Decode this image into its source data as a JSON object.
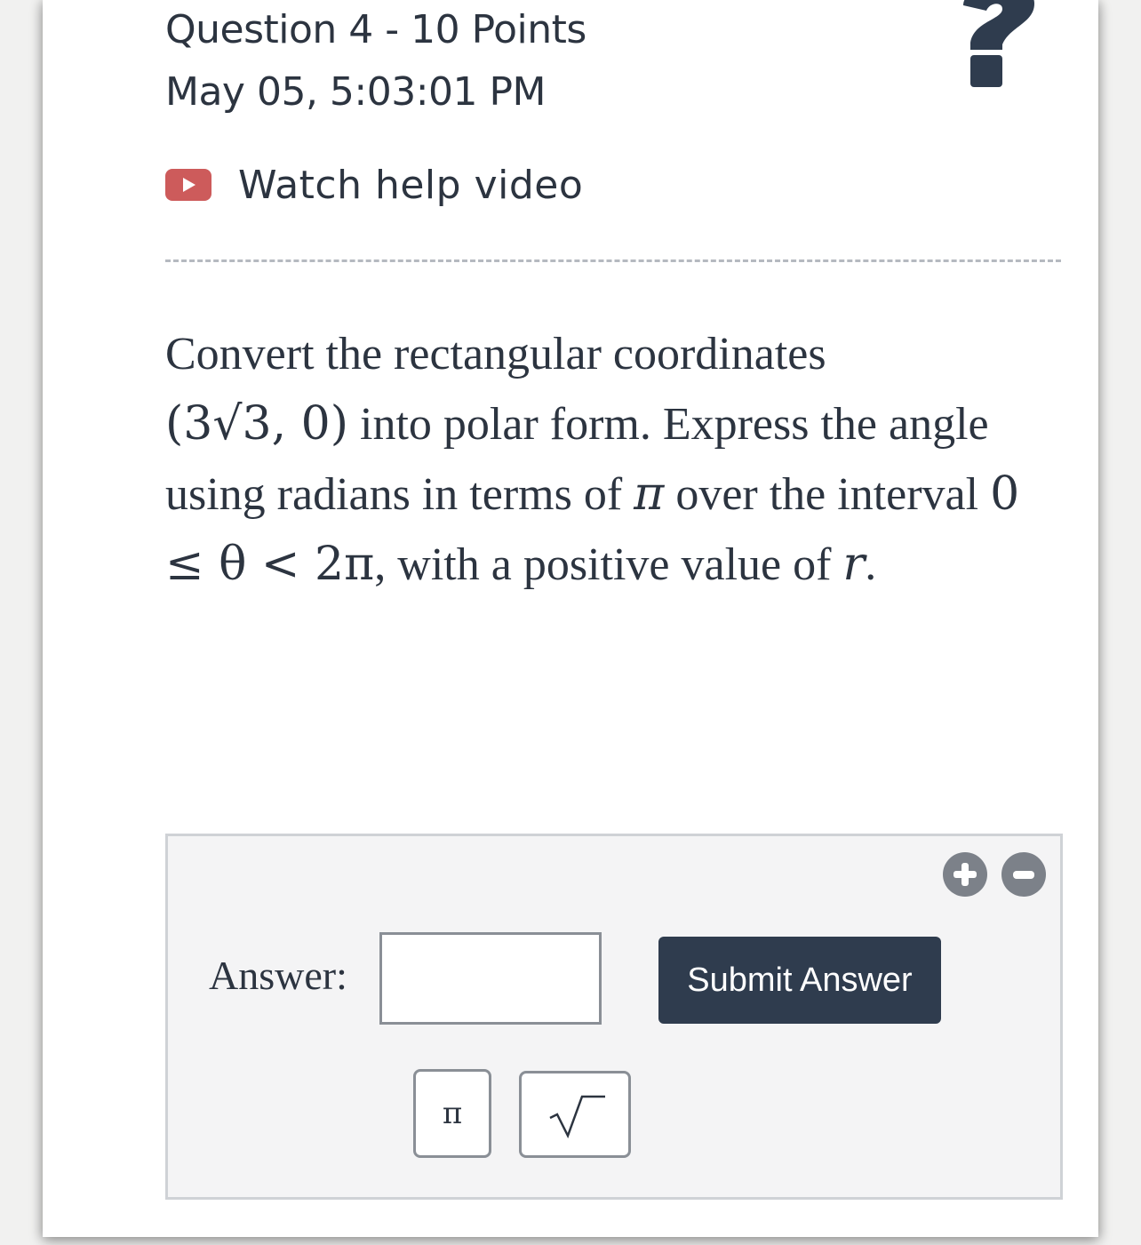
{
  "header": {
    "question_title": "Question 4 - 10 Points",
    "timestamp": "May 05, 5:03:01 PM",
    "help_icon": "question-mark-icon"
  },
  "help_video": {
    "icon": "video-play-icon",
    "label": "Watch help video"
  },
  "question": {
    "p1": "Convert the rectangular coordinates",
    "coord_open": "(3√3, 0)",
    "p2": " into polar form. Express the angle using radians in terms of ",
    "pi": "π",
    "p3": " over the interval ",
    "interval": "0 ≤ θ < 2π",
    "p4": ", with a positive value of ",
    "r": "r",
    "p5": "."
  },
  "answer": {
    "label": "Answer:",
    "value": "",
    "placeholder": "",
    "submit_label": "Submit Answer",
    "pi_button_label": "π",
    "sqrt_button_icon": "sqrt-icon",
    "zoom_in_icon": "plus-circle-icon",
    "zoom_out_icon": "minus-circle-icon"
  },
  "colors": {
    "text": "#2c3440",
    "video_icon": "#cd5b5b",
    "submit_bg": "#2f3c4e",
    "panel_bg": "#f4f4f5"
  }
}
